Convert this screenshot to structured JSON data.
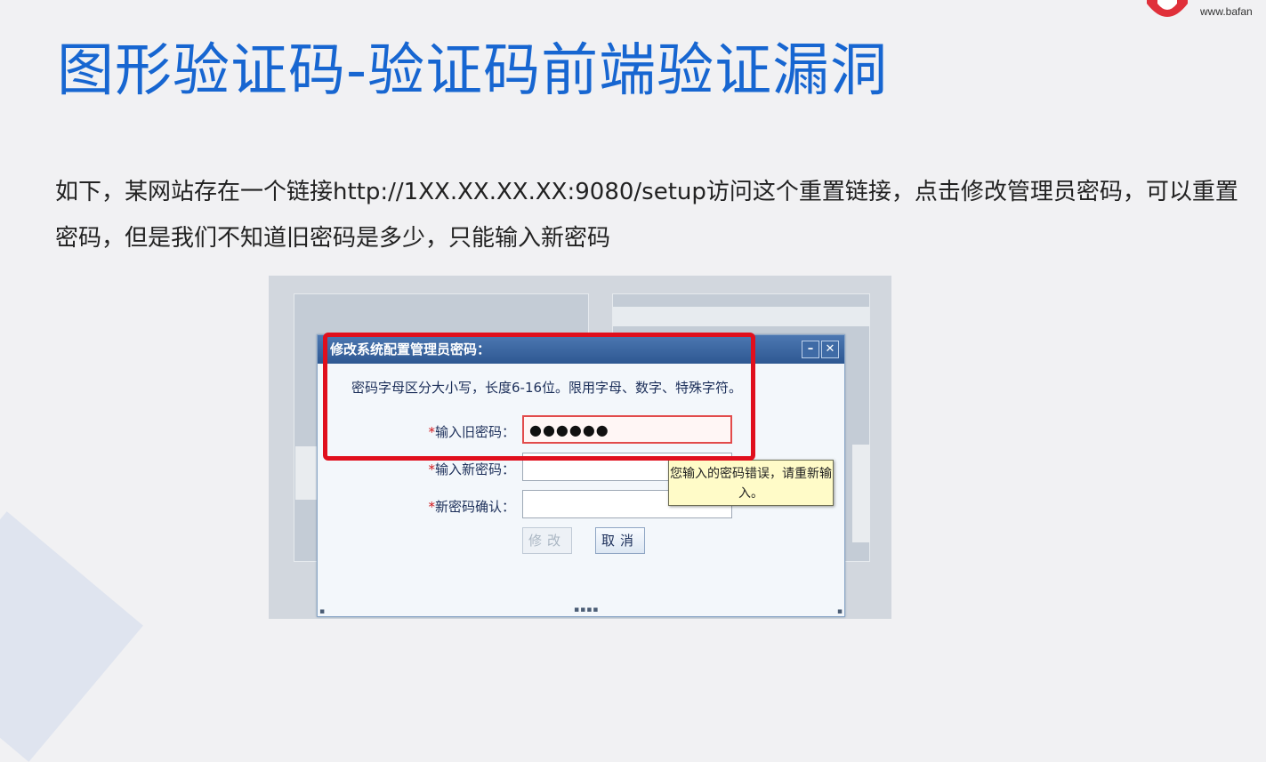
{
  "header": {
    "brand_url": "www.bafan",
    "title": "图形验证码-验证码前端验证漏洞"
  },
  "body": {
    "paragraph": "如下，某网站存在一个链接http://1XX.XX.XX.XX:9080/setup访问这个重置链接，点击修改管理员密码，可以重置密码，但是我们不知道旧密码是多少，只能输入新密码"
  },
  "dialog": {
    "title": "修改系统配置管理员密码：",
    "minimize_glyph": "–",
    "close_glyph": "✕",
    "hint": "密码字母区分大小写，长度6-16位。限用字母、数字、特殊字符。",
    "required_mark": "*",
    "fields": [
      {
        "label": "输入旧密码：",
        "value": "●●●●●●"
      },
      {
        "label": "输入新密码：",
        "value": ""
      },
      {
        "label": "新密码确认：",
        "value": ""
      }
    ],
    "tooltip": "您输入的密码错误，请重新输入。",
    "submit_label": "修改",
    "cancel_label": "取消"
  },
  "colors": {
    "title_blue": "#1766d1",
    "highlight_red": "#e00f1d",
    "dialog_titlebar": "#2e5892",
    "tooltip_bg": "#fffbc8"
  },
  "icons": [
    "brand-logo-icon",
    "minimize-icon",
    "close-icon"
  ]
}
